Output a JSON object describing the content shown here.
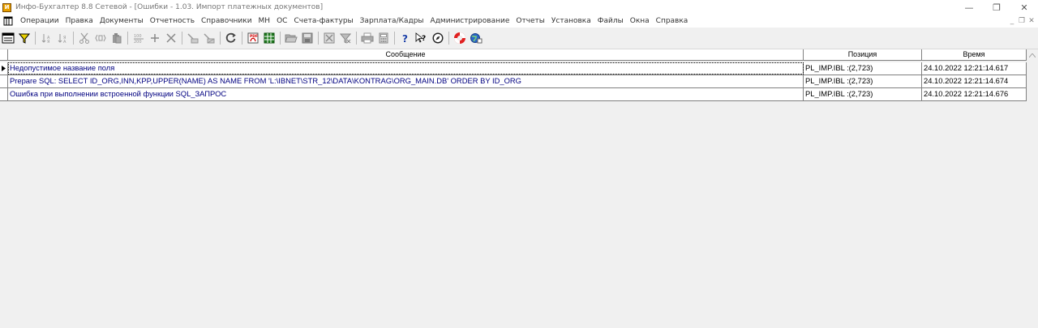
{
  "window": {
    "title": "Инфо-Бухгалтер 8.8 Сетевой - [Ошибки - 1.03. Импорт платежных документов]",
    "controls": {
      "minimize": "—",
      "restore": "❐",
      "close": "✕"
    }
  },
  "menu": {
    "items": [
      "Операции",
      "Правка",
      "Документы",
      "Отчетность",
      "Справочники",
      "МН",
      "ОС",
      "Счета-фактуры",
      "Зарплата/Кадры",
      "Администрирование",
      "Отчеты",
      "Установка",
      "Файлы",
      "Окна",
      "Справка"
    ],
    "mdi_controls": {
      "minimize": "_",
      "restore": "❐",
      "close": "✕"
    }
  },
  "toolbar": {
    "buttons": [
      "form-icon",
      "filter-icon",
      "sort-asc-icon",
      "sort-desc-icon",
      "cut-icon",
      "copy-icon",
      "paste-icon",
      "sum-icon",
      "add-icon",
      "delete-icon",
      "mark-icon",
      "unmark-icon",
      "refresh-icon",
      "pdf-icon",
      "excel-icon",
      "open-folder-icon",
      "save-icon",
      "close-doc-icon",
      "clear-filter-icon",
      "print-icon",
      "calculator-icon",
      "help-icon",
      "help-context-icon",
      "compass-icon",
      "lifebuoy-icon",
      "web-icon"
    ]
  },
  "grid": {
    "columns": [
      "Сообщение",
      "Позиция",
      "Время"
    ],
    "rows": [
      {
        "message": "Недопустимое название поля",
        "position": "PL_IMP.IBL :(2,723)",
        "time": "24.10.2022 12:21:14.617"
      },
      {
        "message": "Prepare SQL: SELECT ID_ORG,INN,KPP,UPPER(NAME) AS NAME FROM 'L:\\IBNET\\STR_12\\DATA\\KONTRAG\\ORG_MAIN.DB' ORDER BY ID_ORG",
        "position": "PL_IMP.IBL :(2,723)",
        "time": "24.10.2022 12:21:14.674"
      },
      {
        "message": "Ошибка при выполнении встроенной функции SQL_ЗАПРОС",
        "position": "PL_IMP.IBL :(2,723)",
        "time": "24.10.2022 12:21:14.676"
      }
    ],
    "selected_row": 0
  },
  "colors": {
    "message_text": "#000080",
    "grid_line": "#808080",
    "background": "#f0f0f0"
  }
}
